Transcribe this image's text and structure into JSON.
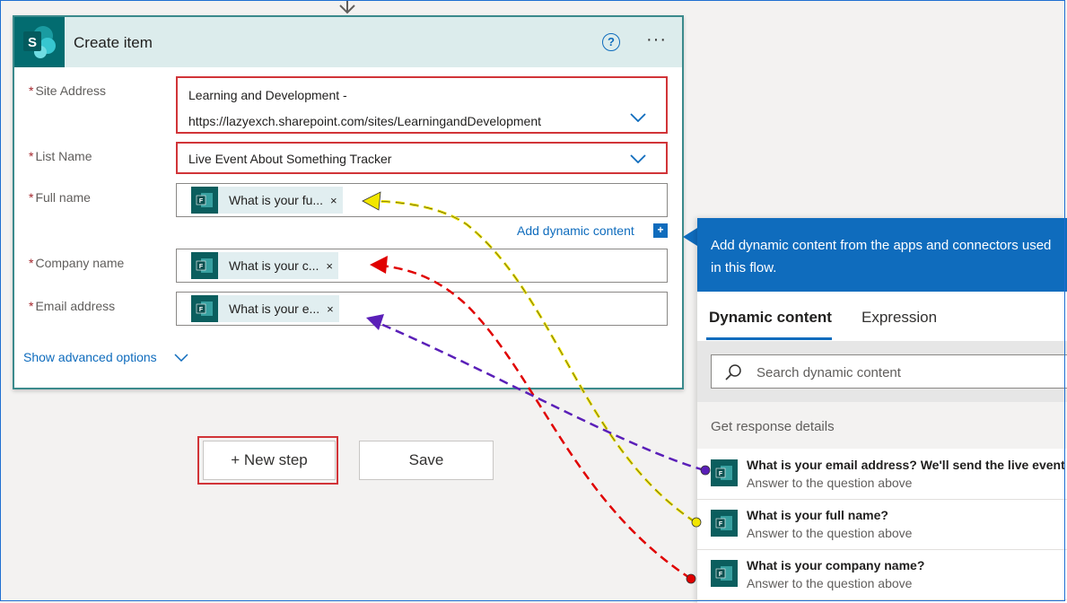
{
  "card": {
    "title": "Create item",
    "fields": {
      "site_address": {
        "label": "Site Address",
        "value_line1": "Learning and Development -",
        "value_line2": "https://lazyexch.sharepoint.com/sites/LearningandDevelopment"
      },
      "list_name": {
        "label": "List Name",
        "value": "Live Event About Something Tracker"
      },
      "full_name": {
        "label": "Full name",
        "token": "What is your fu..."
      },
      "company_name": {
        "label": "Company name",
        "token": "What is your c..."
      },
      "email_address": {
        "label": "Email address",
        "token": "What is your e..."
      }
    },
    "required_mark": "*",
    "help_glyph": "?",
    "more_glyph": "···",
    "token_remove": "×",
    "add_dynamic_content": "Add dynamic content",
    "add_dynamic_plus": "+",
    "show_advanced": "Show advanced options"
  },
  "actions": {
    "new_step": "+ New step",
    "save": "Save"
  },
  "dynamic_panel": {
    "header": "Add dynamic content from the apps and connectors used in this flow.",
    "tabs": {
      "dynamic": "Dynamic content",
      "expression": "Expression"
    },
    "search_placeholder": "Search dynamic content",
    "section": "Get response details",
    "items": [
      {
        "title": "What is your email address? We'll send the live event",
        "subtitle": "Answer to the question above"
      },
      {
        "title": "What is your full name?",
        "subtitle": "Answer to the question above"
      },
      {
        "title": "What is your company name?",
        "subtitle": "Answer to the question above"
      }
    ]
  },
  "icons": {
    "connector": "sharepoint-icon",
    "forms": "forms-icon",
    "chevron": "chevron-down-icon",
    "search": "search-icon"
  },
  "colors": {
    "accent": "#0f6cbd",
    "sharepoint": "#036c70",
    "forms": "#0b5e5e",
    "highlight_red": "#d13438",
    "arrow_yellow": "#f2e600",
    "arrow_red": "#e00000",
    "arrow_purple": "#5a1fb8"
  }
}
